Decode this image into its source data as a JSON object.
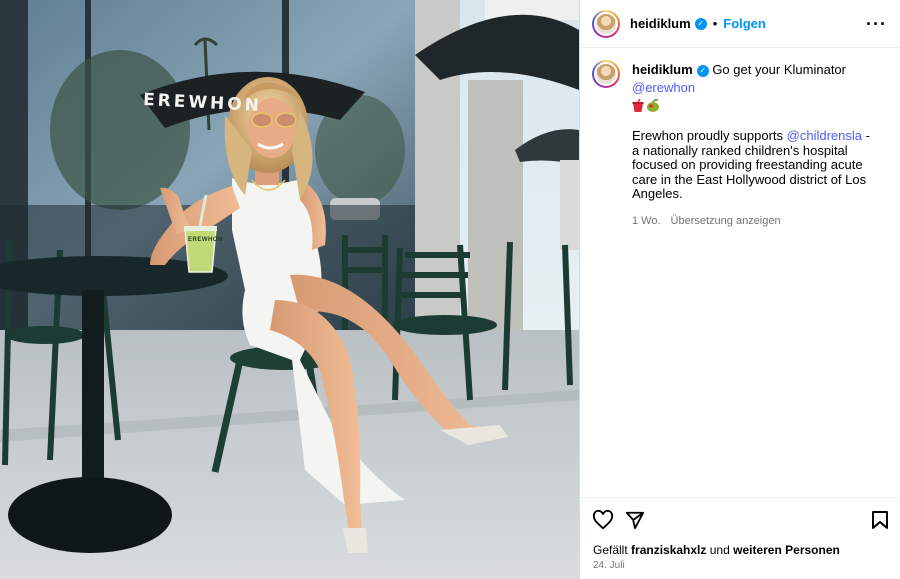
{
  "post": {
    "username": "heidiklum",
    "follow_label": "Folgen",
    "separator": "•",
    "more_icon": "more-horizontal-icon",
    "caption_lead": "Go get your Kluminator",
    "caption_mention": "@erewhon",
    "caption_emojis": [
      "cup-with-straw-emoji",
      "olive-emoji"
    ],
    "description_pre": "Erewhon proudly supports",
    "description_mention": "@childrensla",
    "description_post": "- a nationally ranked children's hospital focused on providing freestanding acute care in the East Hollywood district of Los Angeles.",
    "time_ago": "1 Wo.",
    "translate_label": "Übersetzung anzeigen",
    "likes_prefix": "Gefällt",
    "likes_user": "franziskahxlz",
    "likes_middle": "und",
    "likes_others": "weiteren Personen",
    "date": "24. Juli"
  },
  "photo": {
    "storefront_sign": "EREWHON",
    "cup_label": "EREWHON"
  },
  "colors": {
    "accent_blue": "#0095f6",
    "mention_blue": "#4d5cff",
    "muted_gray": "#737373"
  }
}
